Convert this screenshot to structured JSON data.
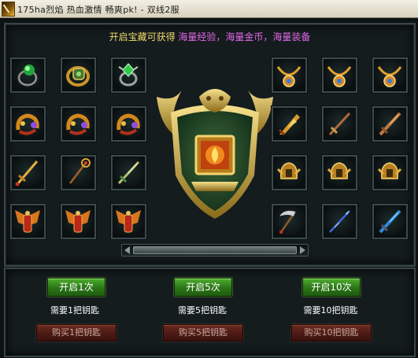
{
  "window": {
    "title": "175ha烈焰 热血激情 畅爽pk! - 双线2服"
  },
  "notice": {
    "prefix": "开启宝藏可获得",
    "highlight": "海量经验，海量金币，海量装备"
  },
  "left_items": [
    "emerald-ring-icon",
    "jade-gold-ring-icon",
    "green-gem-ring-icon",
    "dragon-bracelet-icon",
    "dragon-bracelet-icon",
    "dragon-bracelet-icon",
    "golden-sword-icon",
    "golden-staff-icon",
    "jade-sword-icon",
    "winged-armor-icon",
    "winged-armor-icon",
    "winged-armor-icon"
  ],
  "right_items": [
    "dragon-necklace-icon",
    "dragon-necklace-icon",
    "dragon-necklace-icon",
    "flame-blade-icon",
    "bronze-sword-icon",
    "bronze-blade-icon",
    "golden-helmet-icon",
    "golden-helmet-icon",
    "golden-helmet-icon",
    "scythe-icon",
    "blue-spear-icon",
    "blue-blade-icon"
  ],
  "chests": [
    {
      "open_label": "开启1次",
      "need_label": "需要1把钥匙",
      "buy_label": "购买1把钥匙"
    },
    {
      "open_label": "开启5次",
      "need_label": "需要5把钥匙",
      "buy_label": "购买5把钥匙"
    },
    {
      "open_label": "开启10次",
      "need_label": "需要10把钥匙",
      "buy_label": "购买10把钥匙"
    }
  ],
  "colors": {
    "notice_text": "#f2d96a",
    "notice_highlight": "#e468e8",
    "open_button": "#2a7417",
    "buy_button": "#4a1a14"
  }
}
